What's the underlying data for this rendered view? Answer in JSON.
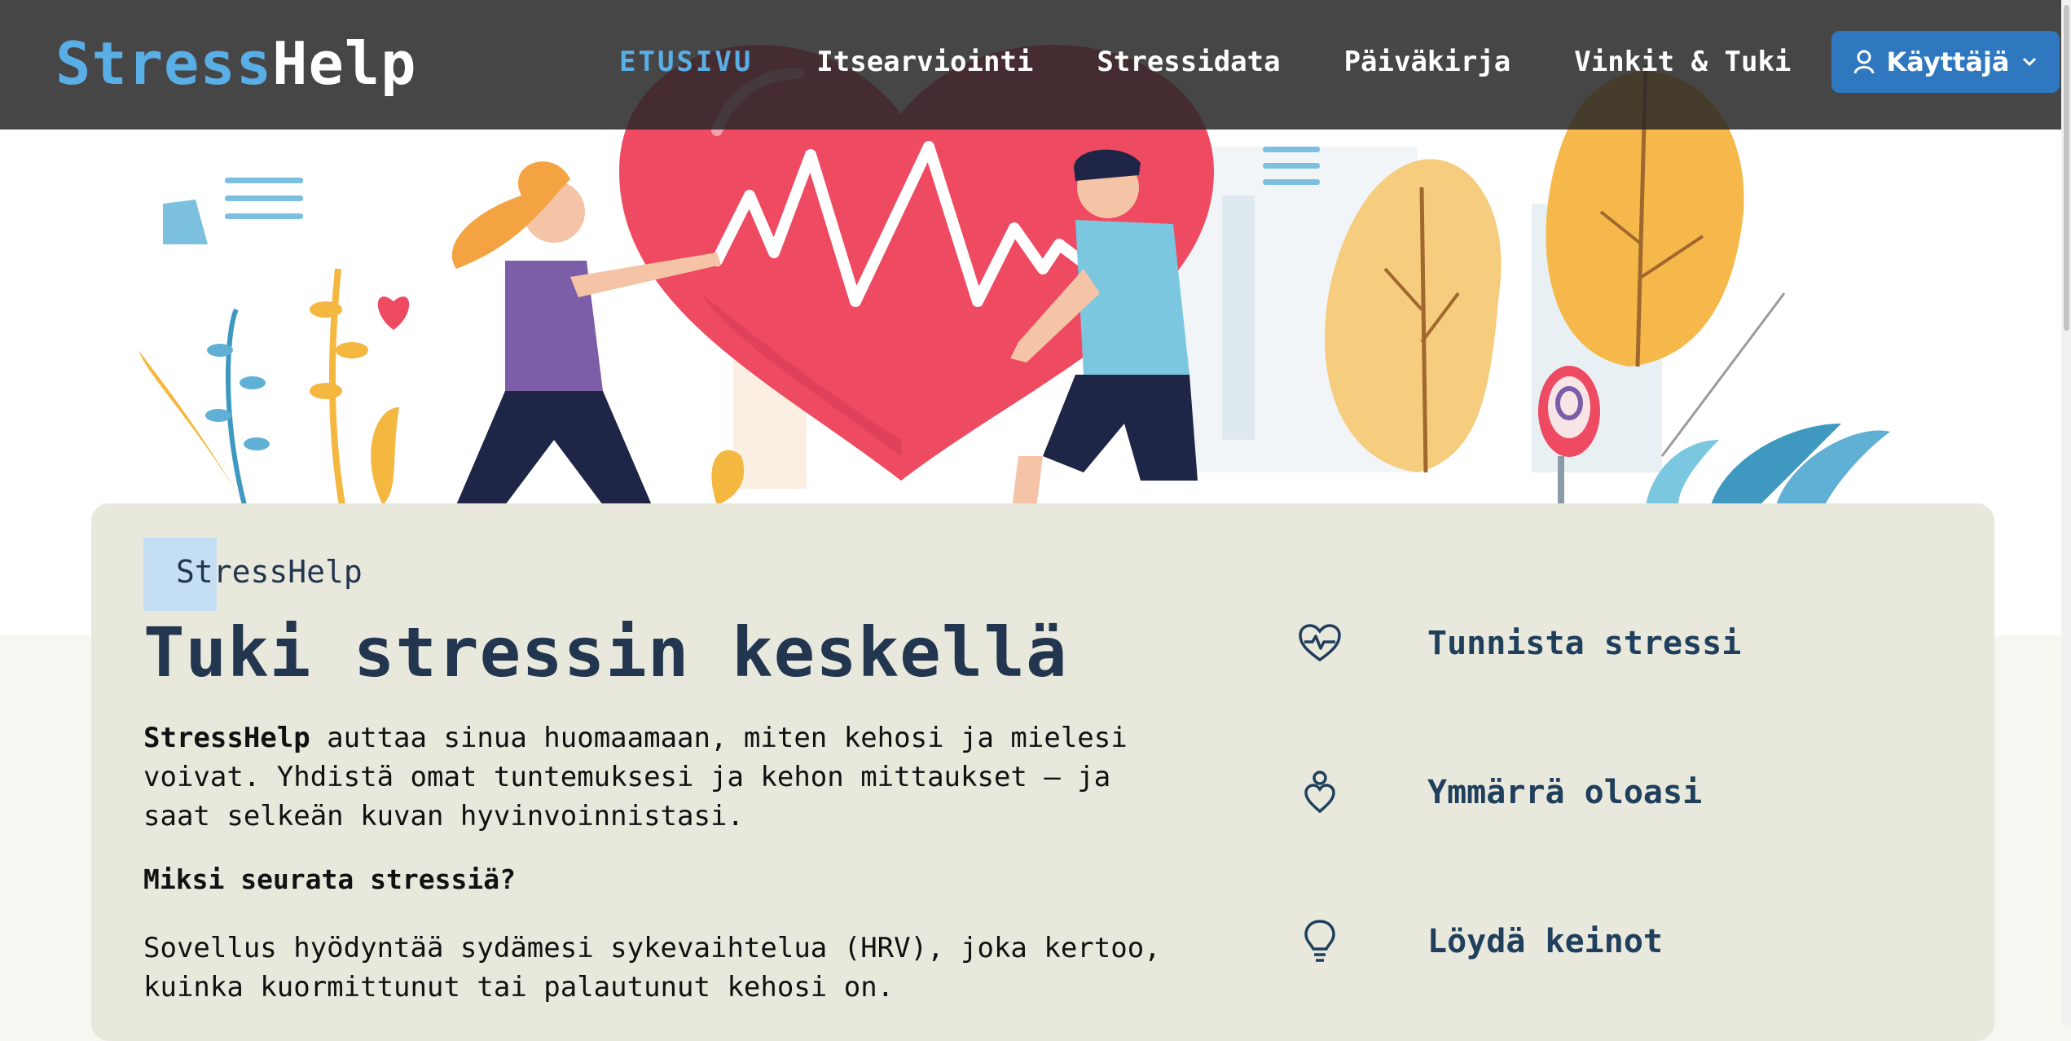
{
  "brand": {
    "part1": "Stress",
    "part2": "Help"
  },
  "nav": {
    "items": [
      {
        "label": "ETUSIVU",
        "active": true
      },
      {
        "label": "Itsearviointi",
        "active": false
      },
      {
        "label": "Stressidata",
        "active": false
      },
      {
        "label": "Päiväkirja",
        "active": false
      },
      {
        "label": "Vinkit & Tuki",
        "active": false
      }
    ],
    "user_label": "Käyttäjä",
    "user_icon": "user-icon",
    "dropdown_icon": "chevron-down-icon"
  },
  "hero": {
    "eyebrow": "StressHelp",
    "title": "Tuki stressin keskellä",
    "lead_brand": "StressHelp",
    "lead_text": " auttaa sinua huomaamaan, miten kehosi ja mielesi voivat. Yhdistä omat tuntemuksesi ja kehon mittaukset – ja saat selkeän kuvan hyvinvoinnistasi.",
    "subheading": "Miksi seurata stressiä?",
    "paragraph": "Sovellus hyödyntää sydämesi sykevaihtelua (HRV), joka kertoo, kuinka kuormittunut tai palautunut kehosi on."
  },
  "features": [
    {
      "icon": "heart-pulse-icon",
      "label": "Tunnista stressi"
    },
    {
      "icon": "heart-person-icon",
      "label": "Ymmärrä oloasi"
    },
    {
      "icon": "lightbulb-icon",
      "label": "Löydä keinot"
    }
  ],
  "colors": {
    "accent": "#5aaee6",
    "button": "#2f78c0",
    "heading": "#23364f",
    "card": "#e9e8dd"
  }
}
